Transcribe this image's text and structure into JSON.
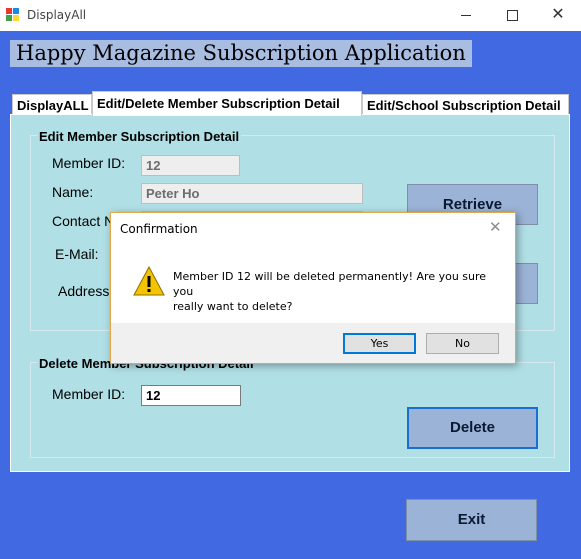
{
  "window": {
    "title": "DisplayAll",
    "controls": {
      "minimize": "minimize",
      "maximize": "maximize",
      "close": "✕"
    }
  },
  "banner": {
    "title": "Happy Magazine Subscription Application"
  },
  "tabs": [
    {
      "label": "DisplayALL",
      "active": false
    },
    {
      "label": "Edit/Delete Member Subscription Detail",
      "active": true
    },
    {
      "label": "Edit/School Subscription Detail",
      "active": false
    }
  ],
  "edit_group": {
    "title": "Edit Member Subscription Detail",
    "member_id_label": "Member ID:",
    "member_id_value": "12",
    "name_label": "Name:",
    "name_value": "Peter Ho",
    "contact_label": "Contact N",
    "email_label": "E-Mail:",
    "address_label": "Address:",
    "retrieve_button": "Retrieve"
  },
  "delete_group": {
    "title": "Delete Member Subscription Detail",
    "member_id_label": "Member ID:",
    "member_id_value": "12",
    "delete_button": "Delete"
  },
  "exit_button": "Exit",
  "dialog": {
    "title": "Confirmation",
    "close": "✕",
    "icon": "warning-icon",
    "message_line1": "Member ID 12 will be deleted permanently! Are you sure you",
    "message_line2": "really want to delete?",
    "yes_button": "Yes",
    "no_button": "No"
  },
  "colors": {
    "background": "#4169e1",
    "tab_page": "#b0e0e6",
    "button": "#9bb3d6",
    "banner": "#a9bde0",
    "dialog_border": "#e0a84c",
    "warning": "#f5c400"
  }
}
